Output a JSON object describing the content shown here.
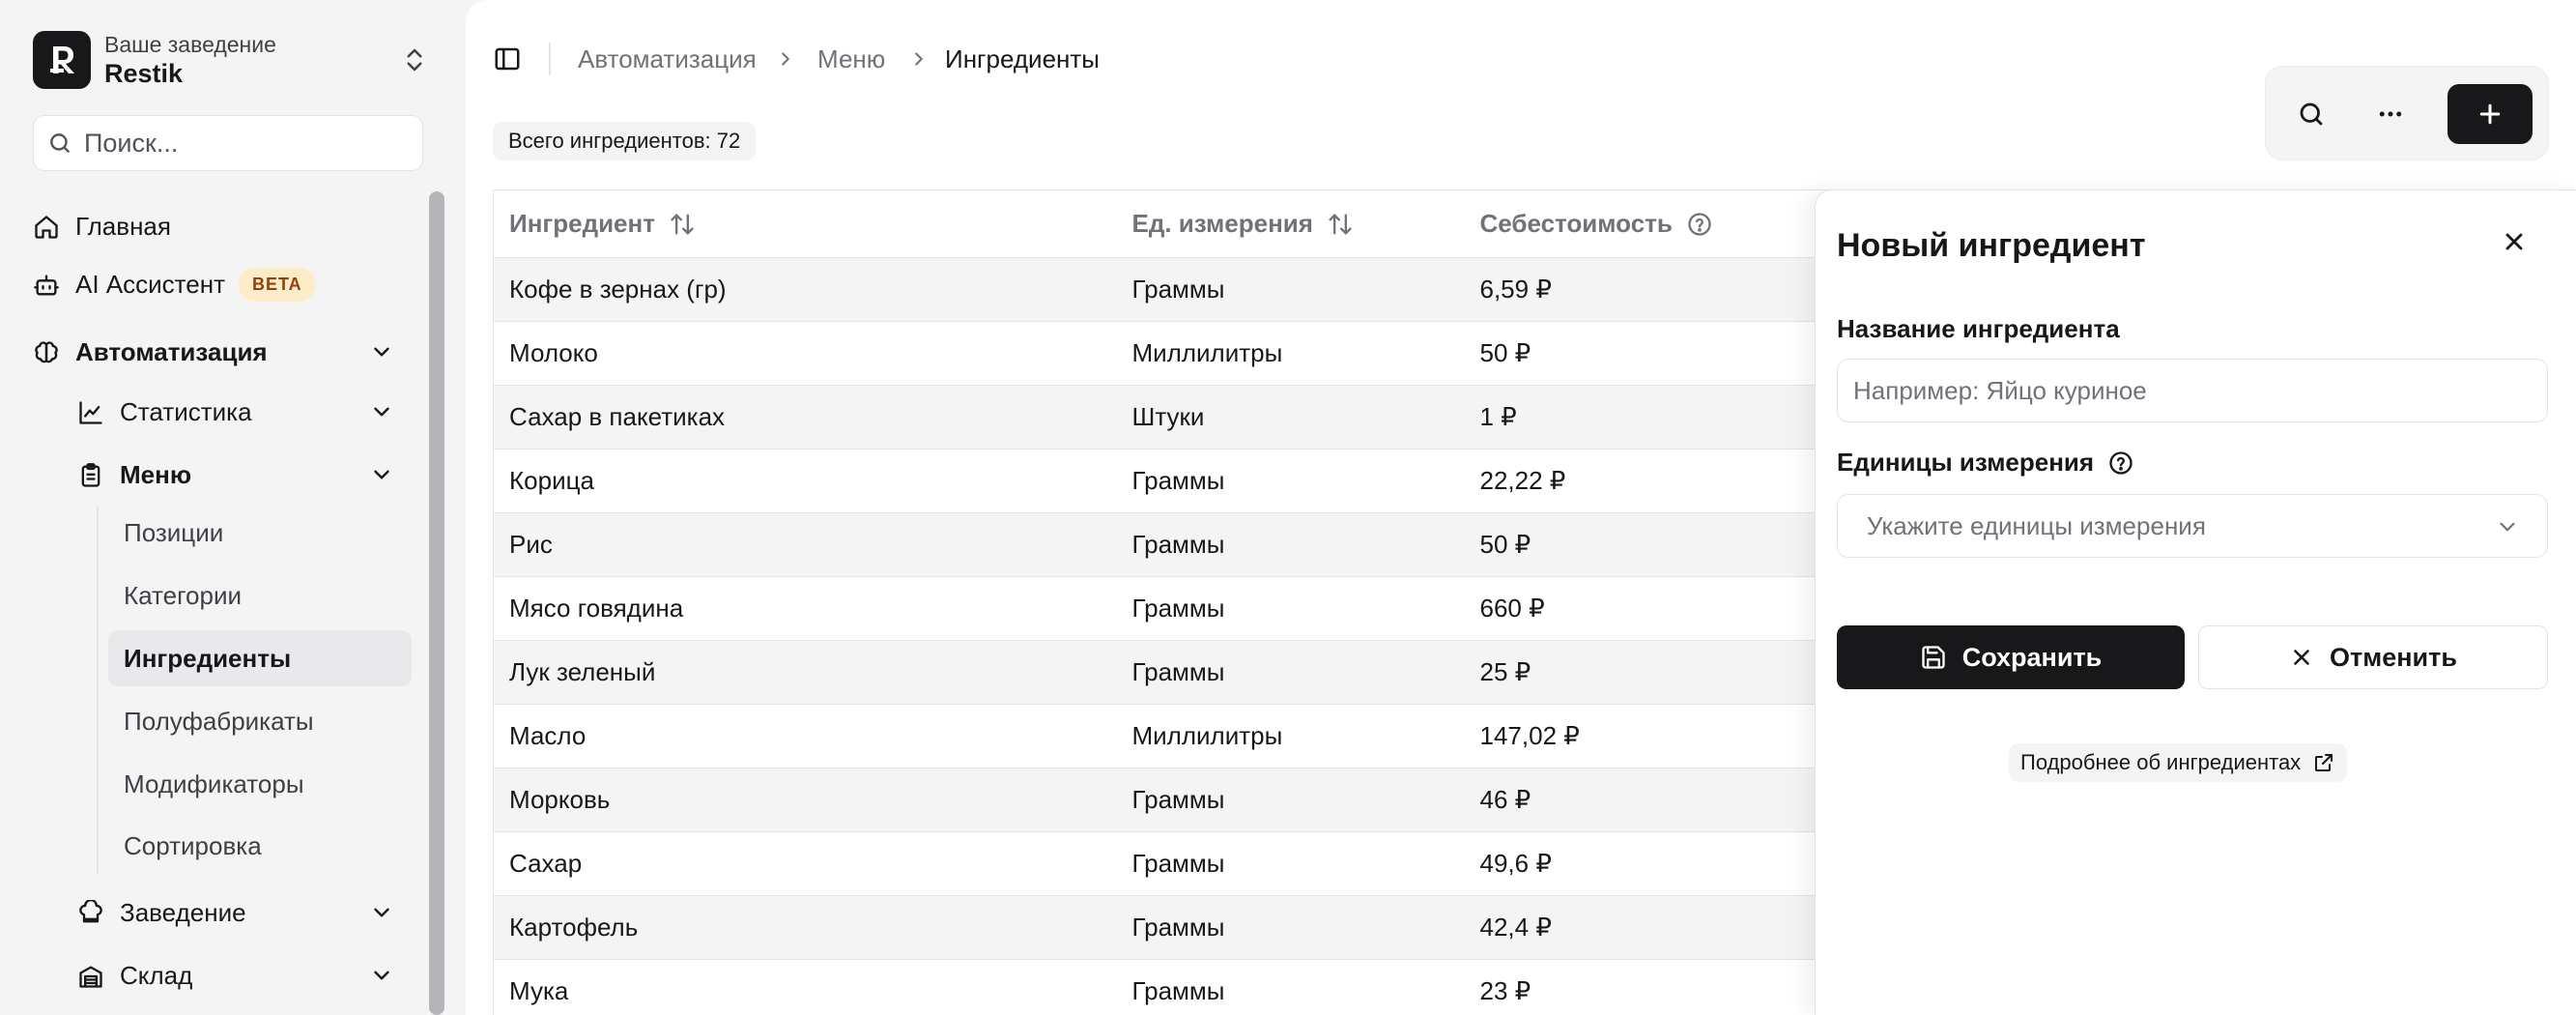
{
  "workspace": {
    "caption": "Ваше заведение",
    "name": "Restik",
    "logo_letter": "R"
  },
  "sidebar": {
    "search_placeholder": "Поиск...",
    "home": "Главная",
    "ai_assistant": "AI Ассистент",
    "beta_badge": "BETA",
    "automation": "Автоматизация",
    "statistics": "Статистика",
    "menu": "Меню",
    "menu_items": [
      "Позиции",
      "Категории",
      "Ингредиенты",
      "Полуфабрикаты",
      "Модификаторы",
      "Сортировка"
    ],
    "active_menu_item": "Ингредиенты",
    "establishment": "Заведение",
    "warehouse": "Склад"
  },
  "breadcrumb": [
    "Автоматизация",
    "Меню",
    "Ингредиенты"
  ],
  "summary": {
    "total_label": "Всего ингредиентов: 72"
  },
  "table": {
    "columns": [
      "Ингредиент",
      "Ед. измерения",
      "Себестоимость"
    ],
    "rows": [
      [
        "Кофе в зернах (гр)",
        "Граммы",
        "6,59 ₽"
      ],
      [
        "Молоко",
        "Миллилитры",
        "50 ₽"
      ],
      [
        "Сахар в пакетиках",
        "Штуки",
        "1 ₽"
      ],
      [
        "Корица",
        "Граммы",
        "22,22 ₽"
      ],
      [
        "Рис",
        "Граммы",
        "50 ₽"
      ],
      [
        "Мясо говядина",
        "Граммы",
        "660 ₽"
      ],
      [
        "Лук зеленый",
        "Граммы",
        "25 ₽"
      ],
      [
        "Масло",
        "Миллилитры",
        "147,02 ₽"
      ],
      [
        "Морковь",
        "Граммы",
        "46 ₽"
      ],
      [
        "Сахар",
        "Граммы",
        "49,6 ₽"
      ],
      [
        "Картофель",
        "Граммы",
        "42,4 ₽"
      ],
      [
        "Мука",
        "Граммы",
        "23 ₽"
      ]
    ]
  },
  "drawer": {
    "title": "Новый ингредиент",
    "name_label": "Название ингредиента",
    "name_placeholder": "Например: Яйцо куриное",
    "name_value": "",
    "unit_label": "Единицы измерения",
    "unit_placeholder": "Укажите единицы измерения",
    "save": "Сохранить",
    "cancel": "Отменить",
    "more_link": "Подробнее об ингредиентах"
  },
  "colors": {
    "primary": "#18181b",
    "muted_text": "#71717a",
    "row_stripe": "#f4f4f5",
    "beta_bg": "#fdecc8",
    "beta_text": "#92400e"
  },
  "icons": [
    "logo-r",
    "chevrons-up-down",
    "search",
    "home",
    "bot",
    "brain",
    "chevron-down",
    "chart-line",
    "clipboard-list",
    "chef-hat",
    "warehouse",
    "panel-left",
    "chevron-right",
    "more-horizontal",
    "plus",
    "arrow-up-down",
    "help-circle",
    "x",
    "save",
    "external-link"
  ]
}
